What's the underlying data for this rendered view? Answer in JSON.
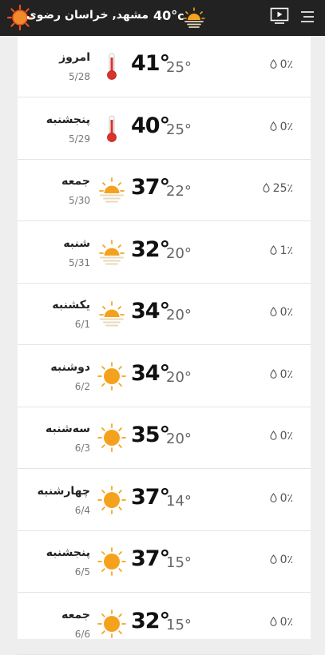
{
  "header": {
    "location": "مشهد, خراسان رضوی",
    "temperature": "40°",
    "unit": "c",
    "icons": {
      "brand": "sun-brand-icon",
      "weather": "sun-haze-icon",
      "tv": "tv-play-icon",
      "menu": "hamburger-menu-icon"
    }
  },
  "colors": {
    "topbar": "#222222",
    "sun": "#f4a21e",
    "thermometer": "#d9332b",
    "background": "#eeeeee",
    "card": "#ffffff"
  },
  "days": [
    {
      "name": "امروز",
      "date": "5/28",
      "high": "41°",
      "low": "25°",
      "precip": "0٪",
      "icon": "thermometer-hot-icon"
    },
    {
      "name": "پنجشنبه",
      "date": "5/29",
      "high": "40°",
      "low": "25°",
      "precip": "0٪",
      "icon": "thermometer-hot-icon"
    },
    {
      "name": "جمعه",
      "date": "5/30",
      "high": "37°",
      "low": "22°",
      "precip": "25٪",
      "icon": "sun-haze-icon"
    },
    {
      "name": "شنبه",
      "date": "5/31",
      "high": "32°",
      "low": "20°",
      "precip": "1٪",
      "icon": "sun-haze-icon"
    },
    {
      "name": "یکشنبه",
      "date": "6/1",
      "high": "34°",
      "low": "20°",
      "precip": "0٪",
      "icon": "sun-haze-icon"
    },
    {
      "name": "دوشنبه",
      "date": "6/2",
      "high": "34°",
      "low": "20°",
      "precip": "0٪",
      "icon": "sun-icon"
    },
    {
      "name": "سه‌شنبه",
      "date": "6/3",
      "high": "35°",
      "low": "20°",
      "precip": "0٪",
      "icon": "sun-icon"
    },
    {
      "name": "چهارشنبه",
      "date": "6/4",
      "high": "37°",
      "low": "14°",
      "precip": "0٪",
      "icon": "sun-icon"
    },
    {
      "name": "پنجشنبه",
      "date": "6/5",
      "high": "37°",
      "low": "15°",
      "precip": "0٪",
      "icon": "sun-icon"
    },
    {
      "name": "جمعه",
      "date": "6/6",
      "high": "32°",
      "low": "15°",
      "precip": "0٪",
      "icon": "sun-icon"
    }
  ]
}
